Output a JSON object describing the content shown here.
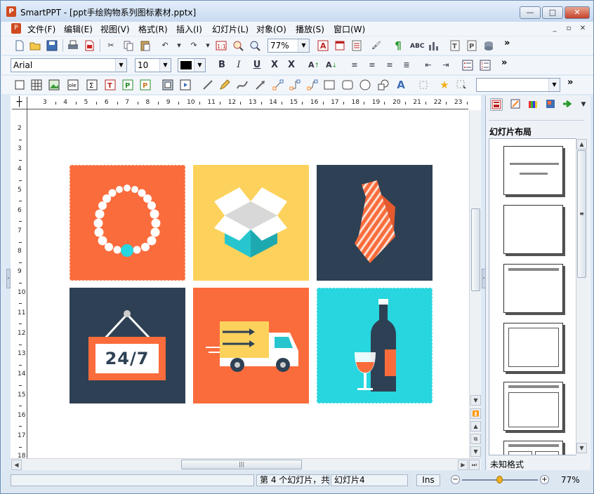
{
  "window": {
    "app_name": "SmartPPT",
    "title": "SmartPPT - [ppt手绘购物系列图标素材.pptx]",
    "min_label": "—",
    "max_label": "□",
    "close_label": "✕"
  },
  "menu": {
    "items": [
      "文件(F)",
      "编辑(E)",
      "视图(V)",
      "格式(R)",
      "插入(I)",
      "幻灯片(L)",
      "对象(O)",
      "播放(S)",
      "窗口(W)"
    ],
    "mdi_buttons": [
      "_",
      "▫",
      "✕"
    ]
  },
  "toolbar_standard": {
    "zoom_value": "77%",
    "overflow": "»"
  },
  "toolbar_format": {
    "font_name": "Arial",
    "font_size": "10",
    "overflow": "»"
  },
  "toolbar_draw": {
    "overflow": "»"
  },
  "ruler": {
    "h_numbers": [
      "3",
      "4",
      "5",
      "6",
      "7",
      "8",
      "9",
      "10",
      "11",
      "12",
      "13",
      "14",
      "15",
      "16",
      "17",
      "18",
      "19",
      "20",
      "21",
      "22",
      "23"
    ],
    "v_numbers": [
      "2",
      "3",
      "4",
      "5",
      "6",
      "7",
      "8",
      "9",
      "10",
      "11",
      "12",
      "13",
      "14",
      "15",
      "16",
      "17",
      "18"
    ]
  },
  "slide": {
    "tiles": [
      {
        "name": "pearl-necklace",
        "bg": "#fa6c3c",
        "dashed": true
      },
      {
        "name": "gift-box",
        "bg": "#fdd25c",
        "dashed": false
      },
      {
        "name": "striped-tie",
        "bg": "#2e4154",
        "dashed": false
      },
      {
        "name": "open-24-7-sign",
        "bg": "#2e4154",
        "dashed": false,
        "sign_text": "24/7"
      },
      {
        "name": "delivery-truck",
        "bg": "#fa6c3c",
        "dashed": false
      },
      {
        "name": "wine-bottle",
        "bg": "#27d6de",
        "dashed": true
      }
    ]
  },
  "panel": {
    "title": "幻灯片布局",
    "layouts": [
      "title",
      "blank",
      "title-only",
      "centered-text",
      "title-content",
      "two-column"
    ],
    "format_label": "未知格式"
  },
  "statusbar": {
    "slide_info": "第 4 个幻灯片，共",
    "slide_name": "幻灯片4",
    "ins_mode": "Ins",
    "zoom_level": "77%",
    "zoom_fraction": 0.5
  }
}
